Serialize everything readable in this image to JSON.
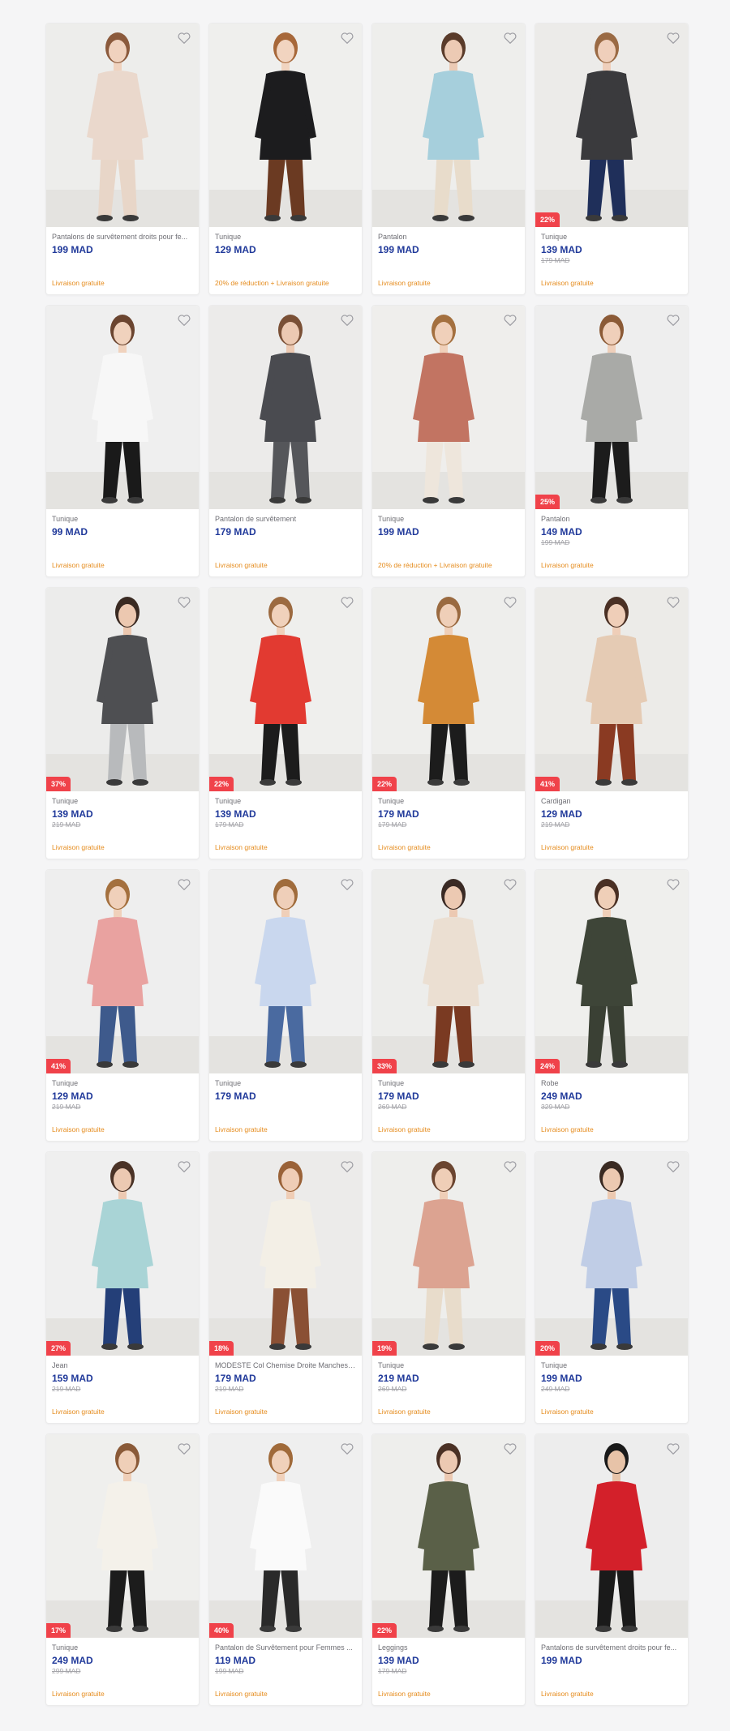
{
  "colors": {
    "price": "#20399a",
    "discount_badge": "#f0424a",
    "promo": "#e58b1c",
    "old_price": "#a3a3a8"
  },
  "products": [
    {
      "name": "Pantalons de survêtement droits pour fe...",
      "price": "199 MAD",
      "old_price": "",
      "discount": "",
      "promo": "Livraison gratuite",
      "bg": "#ededeb",
      "top": "#ead8cc",
      "bottom": "#e8d6c8",
      "skin": "#f0d2be",
      "hair": "#8b5a3c"
    },
    {
      "name": "Tunique",
      "price": "129 MAD",
      "old_price": "",
      "discount": "",
      "promo": "20% de réduction + Livraison gratuite",
      "bg": "#efefed",
      "top": "#1c1c1e",
      "bottom": "#6b3a22",
      "skin": "#f1d4c0",
      "hair": "#a7683a"
    },
    {
      "name": "Pantalon",
      "price": "199 MAD",
      "old_price": "",
      "discount": "",
      "promo": "Livraison gratuite",
      "bg": "#eeeeec",
      "top": "#a6cfdc",
      "bottom": "#e8dccb",
      "skin": "#eccab4",
      "hair": "#5a3b2a"
    },
    {
      "name": "Tunique",
      "price": "139 MAD",
      "old_price": "179 MAD",
      "discount": "22%",
      "promo": "Livraison gratuite",
      "bg": "#ecebe9",
      "top": "#3a3a3d",
      "bottom": "#1f2f5a",
      "skin": "#efcfbb",
      "hair": "#9a6a44"
    },
    {
      "name": "Tunique",
      "price": "99 MAD",
      "old_price": "",
      "discount": "",
      "promo": "Livraison gratuite",
      "bg": "#efefef",
      "top": "#f7f7f7",
      "bottom": "#1a1a1a",
      "skin": "#f0d2bd",
      "hair": "#6b4530"
    },
    {
      "name": "Pantalon de survêtement",
      "price": "179 MAD",
      "old_price": "",
      "discount": "",
      "promo": "Livraison gratuite",
      "bg": "#ecebea",
      "top": "#4a4b50",
      "bottom": "#55565a",
      "skin": "#ecc9b2",
      "hair": "#7a5036"
    },
    {
      "name": "Tunique",
      "price": "199 MAD",
      "old_price": "",
      "discount": "",
      "promo": "20% de réduction + Livraison gratuite",
      "bg": "#efeeec",
      "top": "#c27462",
      "bottom": "#eee6dc",
      "skin": "#f0d0ba",
      "hair": "#a4703f"
    },
    {
      "name": "Pantalon",
      "price": "149 MAD",
      "old_price": "199 MAD",
      "discount": "25%",
      "promo": "Livraison gratuite",
      "bg": "#eeeeee",
      "top": "#a9aaa7",
      "bottom": "#1c1c1c",
      "skin": "#efcfba",
      "hair": "#8b5a36"
    },
    {
      "name": "Tunique",
      "price": "139 MAD",
      "old_price": "219 MAD",
      "discount": "37%",
      "promo": "Livraison gratuite",
      "bg": "#ececeb",
      "top": "#4e4f52",
      "bottom": "#b8babc",
      "skin": "#ecc8b0",
      "hair": "#3a2a22"
    },
    {
      "name": "Tunique",
      "price": "139 MAD",
      "old_price": "179 MAD",
      "discount": "22%",
      "promo": "Livraison gratuite",
      "bg": "#efefed",
      "top": "#e23a31",
      "bottom": "#1c1c1c",
      "skin": "#f0d1bb",
      "hair": "#9c6a40"
    },
    {
      "name": "Tunique",
      "price": "179 MAD",
      "old_price": "179 MAD",
      "discount": "22%",
      "promo": "Livraison gratuite",
      "bg": "#eeeeec",
      "top": "#d48a36",
      "bottom": "#1c1c1c",
      "skin": "#efcfb8",
      "hair": "#9a6a40"
    },
    {
      "name": "Cardigan",
      "price": "129 MAD",
      "old_price": "219 MAD",
      "discount": "41%",
      "promo": "Livraison gratuite",
      "bg": "#ecebe8",
      "top": "#e5cbb4",
      "bottom": "#8a3a22",
      "skin": "#efceb8",
      "hair": "#4a3024"
    },
    {
      "name": "Tunique",
      "price": "129 MAD",
      "old_price": "219 MAD",
      "discount": "41%",
      "promo": "Livraison gratuite",
      "bg": "#eeeeee",
      "top": "#e9a2a0",
      "bottom": "#3e5a8c",
      "skin": "#f0d0ba",
      "hair": "#a4703e"
    },
    {
      "name": "Tunique",
      "price": "179 MAD",
      "old_price": "",
      "discount": "",
      "promo": "Livraison gratuite",
      "bg": "#efefef",
      "top": "#c9d7ee",
      "bottom": "#4a6aa0",
      "skin": "#efcfb9",
      "hair": "#a06c3c"
    },
    {
      "name": "Tunique",
      "price": "179 MAD",
      "old_price": "269 MAD",
      "discount": "33%",
      "promo": "Livraison gratuite",
      "bg": "#ededeb",
      "top": "#ebdfd2",
      "bottom": "#7a3a22",
      "skin": "#ecc9b2",
      "hair": "#3a2a24"
    },
    {
      "name": "Robe",
      "price": "249 MAD",
      "old_price": "329 MAD",
      "discount": "24%",
      "promo": "Livraison gratuite",
      "bg": "#efefed",
      "top": "#3e4538",
      "bottom": "#3a4034",
      "skin": "#efcfb8",
      "hair": "#4a3024"
    },
    {
      "name": "Jean",
      "price": "159 MAD",
      "old_price": "219 MAD",
      "discount": "27%",
      "promo": "Livraison gratuite",
      "bg": "#efefef",
      "top": "#a9d4d6",
      "bottom": "#243f78",
      "skin": "#ecc9b2",
      "hair": "#4a3226"
    },
    {
      "name": "MODESTE Col Chemise Droite Manches L...",
      "price": "179 MAD",
      "old_price": "219 MAD",
      "discount": "18%",
      "promo": "Livraison gratuite",
      "bg": "#ecebea",
      "top": "#f3efe6",
      "bottom": "#8a5034",
      "skin": "#efcdb6",
      "hair": "#9a6238"
    },
    {
      "name": "Tunique",
      "price": "219 MAD",
      "old_price": "269 MAD",
      "discount": "19%",
      "promo": "Livraison gratuite",
      "bg": "#eeeeec",
      "top": "#dca391",
      "bottom": "#e8dccb",
      "skin": "#efceb7",
      "hair": "#6b4530"
    },
    {
      "name": "Tunique",
      "price": "199 MAD",
      "old_price": "249 MAD",
      "discount": "20%",
      "promo": "Livraison gratuite",
      "bg": "#eeeeee",
      "top": "#c0cde6",
      "bottom": "#2a4a86",
      "skin": "#ecc9b1",
      "hair": "#3a2a22"
    },
    {
      "name": "Tunique",
      "price": "249 MAD",
      "old_price": "299 MAD",
      "discount": "17%",
      "promo": "Livraison gratuite",
      "bg": "#efefed",
      "top": "#f4f1ea",
      "bottom": "#1c1c1c",
      "skin": "#efcfb8",
      "hair": "#8a5a38"
    },
    {
      "name": "Pantalon de Survêtement pour Femmes ...",
      "price": "119 MAD",
      "old_price": "199 MAD",
      "discount": "40%",
      "promo": "Livraison gratuite",
      "bg": "#efefef",
      "top": "#fafafa",
      "bottom": "#2a2a2a",
      "skin": "#f0d1bb",
      "hair": "#a06a3a"
    },
    {
      "name": "Leggings",
      "price": "139 MAD",
      "old_price": "179 MAD",
      "discount": "22%",
      "promo": "Livraison gratuite",
      "bg": "#eeeeec",
      "top": "#5a6048",
      "bottom": "#1c1c1c",
      "skin": "#ecc9b2",
      "hair": "#4a3024"
    },
    {
      "name": "Pantalons de survêtement droits pour fe...",
      "price": "199 MAD",
      "old_price": "",
      "discount": "",
      "promo": "Livraison gratuite",
      "bg": "#ededed",
      "top": "#d3202a",
      "bottom": "#1a1a1a",
      "skin": "#e7c3a8",
      "hair": "#1a1a1a"
    }
  ]
}
